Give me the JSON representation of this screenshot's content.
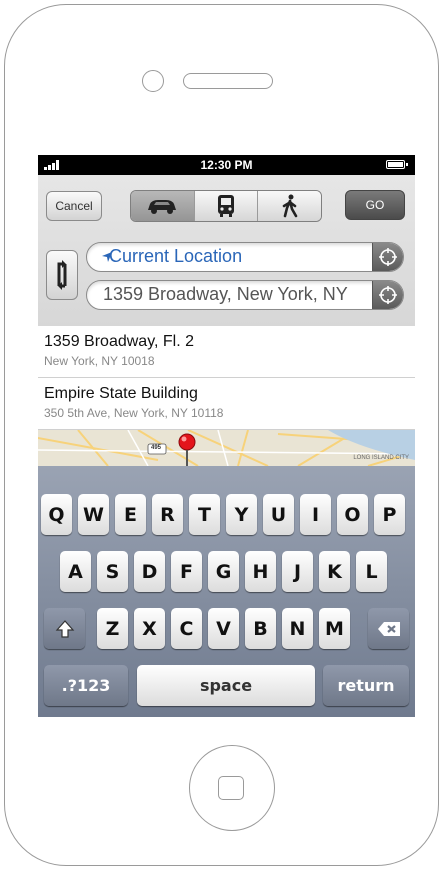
{
  "status": {
    "time": "12:30 PM"
  },
  "toolbar": {
    "cancel_label": "Cancel",
    "go_label": "GO",
    "modes": [
      "car-icon",
      "bus-icon",
      "walk-icon"
    ],
    "active_mode": "car"
  },
  "route": {
    "start": "Current Location",
    "end": "1359 Broadway, New York, NY"
  },
  "suggestions": [
    {
      "title": "1359 Broadway, Fl. 2",
      "subtitle": "New York, NY 10018"
    },
    {
      "title": "Empire State Building",
      "subtitle": "350 5th Ave, New York, NY 10118"
    }
  ],
  "map": {
    "label": "LONG ISLAND CITY",
    "shield": "495"
  },
  "keyboard": {
    "row1": [
      "Q",
      "W",
      "E",
      "R",
      "T",
      "Y",
      "U",
      "I",
      "O",
      "P"
    ],
    "row2": [
      "A",
      "S",
      "D",
      "F",
      "G",
      "H",
      "J",
      "K",
      "L"
    ],
    "row3": [
      "Z",
      "X",
      "C",
      "V",
      "B",
      "N",
      "M"
    ],
    "numbers_label": ".?123",
    "space_label": "space",
    "return_label": "return"
  },
  "colors": {
    "accent": "#2a66b8",
    "keyboard_bg": "#7f899c"
  }
}
